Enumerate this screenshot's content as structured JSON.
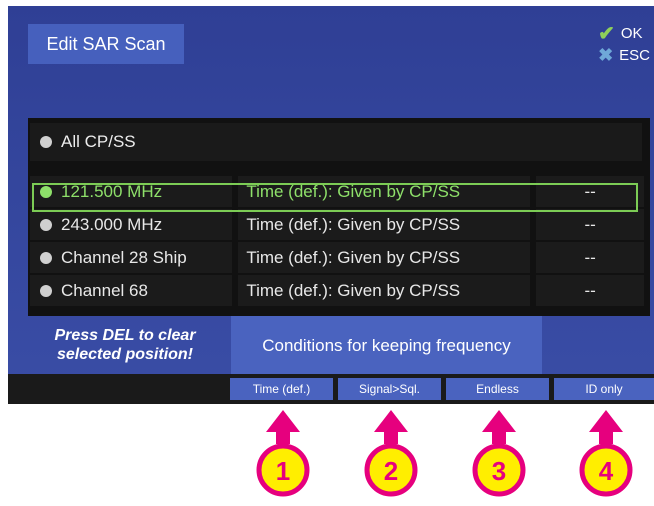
{
  "header": {
    "title": "Edit SAR Scan",
    "ok_label": "OK",
    "esc_label": "ESC"
  },
  "list": {
    "all_label": "All CP/SS",
    "rows": [
      {
        "freq": "121.500 MHz",
        "condition": "Time (def.): Given by CP/SS",
        "id": "--"
      },
      {
        "freq": "243.000 MHz",
        "condition": "Time (def.): Given by CP/SS",
        "id": "--"
      },
      {
        "freq": "Channel 28 Ship",
        "condition": "Time (def.): Given by CP/SS",
        "id": "--"
      },
      {
        "freq": "Channel 68",
        "condition": "Time (def.): Given by CP/SS",
        "id": "--"
      }
    ]
  },
  "hint": {
    "line1": "Press DEL to clear",
    "line2": "selected position!"
  },
  "conditions_title": "Conditions for keeping frequency",
  "softkeys": [
    "Time (def.)",
    "Signal>Sql.",
    "Endless",
    "ID only"
  ],
  "callouts": [
    "1",
    "2",
    "3",
    "4"
  ],
  "colors": {
    "accent_green": "#8ee06a",
    "callout_magenta": "#e6007e",
    "callout_yellow": "#ffee00"
  }
}
